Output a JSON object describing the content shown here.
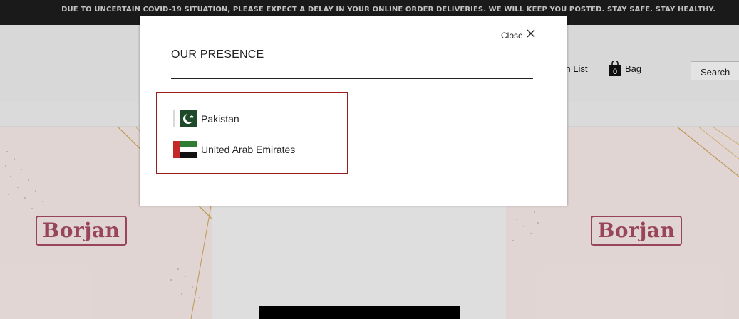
{
  "announcement": "DUE TO UNCERTAIN COVID-19 SITUATION, PLEASE EXPECT A DELAY IN YOUR ONLINE ORDER DELIVERIES. WE WILL KEEP YOU POSTED. STAY SAFE. STAY HEALTHY.",
  "header": {
    "wishlist_label": "ish List",
    "bag_count": "0",
    "bag_label": "Bag",
    "search_label": "Search"
  },
  "banners": {
    "logo_text": "Borjan"
  },
  "modal": {
    "title": "OUR PRESENCE",
    "close_label": "Close",
    "countries": [
      {
        "name": "Pakistan",
        "flag_icon": "pakistan-flag-icon"
      },
      {
        "name": "United Arab Emirates",
        "flag_icon": "uae-flag-icon"
      }
    ]
  },
  "colors": {
    "accent_border": "#9b1c1c",
    "brand": "#a24a5e",
    "topbar": "#1c1c1c"
  }
}
